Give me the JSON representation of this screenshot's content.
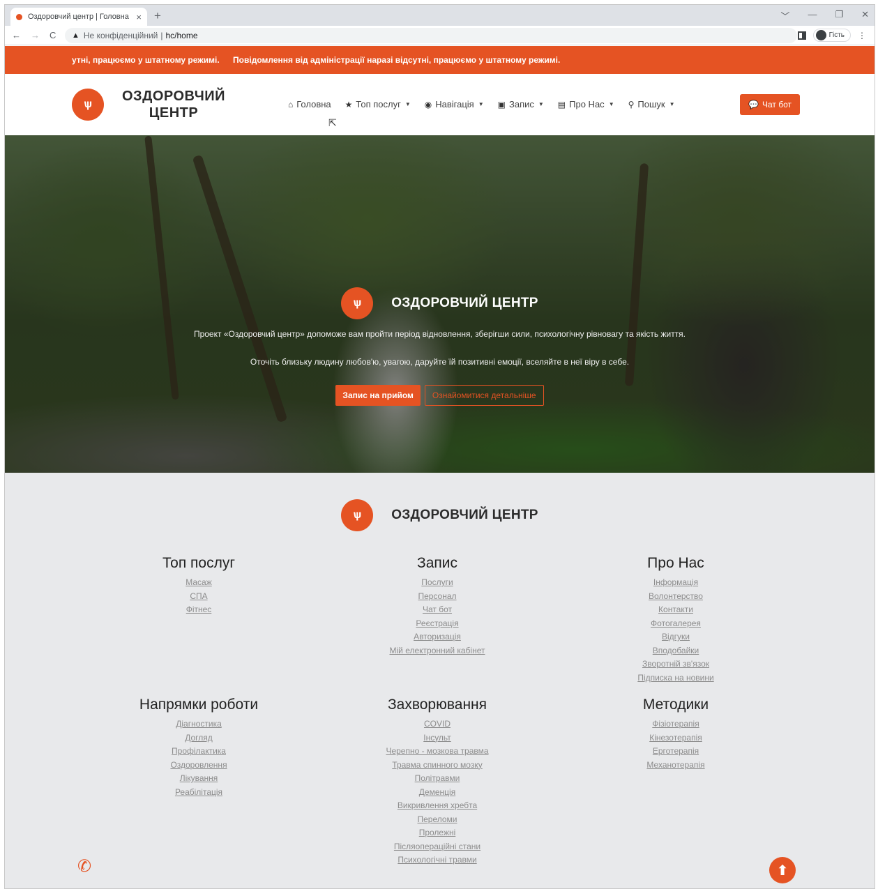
{
  "browser": {
    "tab_title": "Оздоровчий центр | Головна",
    "tab_close": "×",
    "new_tab": "+",
    "security_label": "Не конфіденційний",
    "separator": "|",
    "url": "hc/home",
    "profile_label": "Гість",
    "window_controls": [
      "﹀",
      "—",
      "❐",
      "✕"
    ]
  },
  "ticker": {
    "messages": [
      "утні, працюємо у штатному режимі.",
      "Повідомлення від адміністрації наразі відсутні, працюємо у штатному режимі."
    ]
  },
  "header": {
    "brand_line1": "ОЗДОРОВЧИЙ",
    "brand_line2": "ЦЕНТР",
    "nav": [
      {
        "label": "Головна",
        "icon": "home-icon",
        "glyph": "⌂",
        "caret": ""
      },
      {
        "label": "Топ послуг",
        "icon": "star-icon",
        "glyph": "★",
        "caret": "▼"
      },
      {
        "label": "Навігація",
        "icon": "compass-icon",
        "glyph": "◉",
        "caret": "▼"
      },
      {
        "label": "Запис",
        "icon": "clipboard-icon",
        "glyph": "▣",
        "caret": "▼"
      },
      {
        "label": "Про Нас",
        "icon": "book-icon",
        "glyph": "▤",
        "caret": "▼"
      },
      {
        "label": "Пошук",
        "icon": "search-icon",
        "glyph": "⚲",
        "caret": "▼"
      }
    ],
    "chat_button": "Чат бот"
  },
  "hero": {
    "title": "ОЗДОРОВЧИЙ ЦЕНТР",
    "text1": "Проект «Оздоровчий центр» допоможе вам пройти період відновлення, зберігши сили, психологічну рівновагу та якість життя.",
    "text2": "Оточіть близьку людину любов'ю, увагою, даруйте їй позитивні емоції, вселяйте в неї віру в себе.",
    "primary_button": "Запис на прийом",
    "secondary_button": "Ознайомитися детальніше"
  },
  "footer": {
    "title": "ОЗДОРОВЧИЙ ЦЕНТР",
    "columns": [
      {
        "heading": "Топ послуг",
        "links": [
          "Масаж",
          "СПА",
          "Фітнес"
        ]
      },
      {
        "heading": "Запис",
        "links": [
          "Послуги",
          "Персонал",
          "Чат бот",
          "Реєстрація",
          "Авторизація",
          "Мій електронний кабінет"
        ]
      },
      {
        "heading": "Про Нас",
        "links": [
          "Інформація",
          "Волонтерство",
          "Контакти",
          "Фотогалерея",
          "Відгуки",
          "Вподобайки",
          "Зворотній зв'язок",
          "Підписка на новини"
        ]
      },
      {
        "heading": "Напрямки роботи",
        "links": [
          "Діагностика",
          "Догляд",
          "Профілактика",
          "Оздоровлення",
          "Лікування",
          "Реабілітація"
        ]
      },
      {
        "heading": "Захворювання",
        "links": [
          "COVID",
          "Інсульт",
          "Черепно - мозкова травма",
          "Травма спинного мозку",
          "Політравми",
          "Деменція",
          "Викривлення хребта",
          "Переломи",
          "Пролежні",
          "Післяопераційні стани",
          "Психологічні травми"
        ]
      },
      {
        "heading": "Методики",
        "links": [
          "Фізіотерапія",
          "Кінезотерапія",
          "Ерготерапія",
          "Механотерапія"
        ]
      }
    ]
  },
  "colors": {
    "accent": "#e55323",
    "footer_bg": "#e8e9eb"
  }
}
